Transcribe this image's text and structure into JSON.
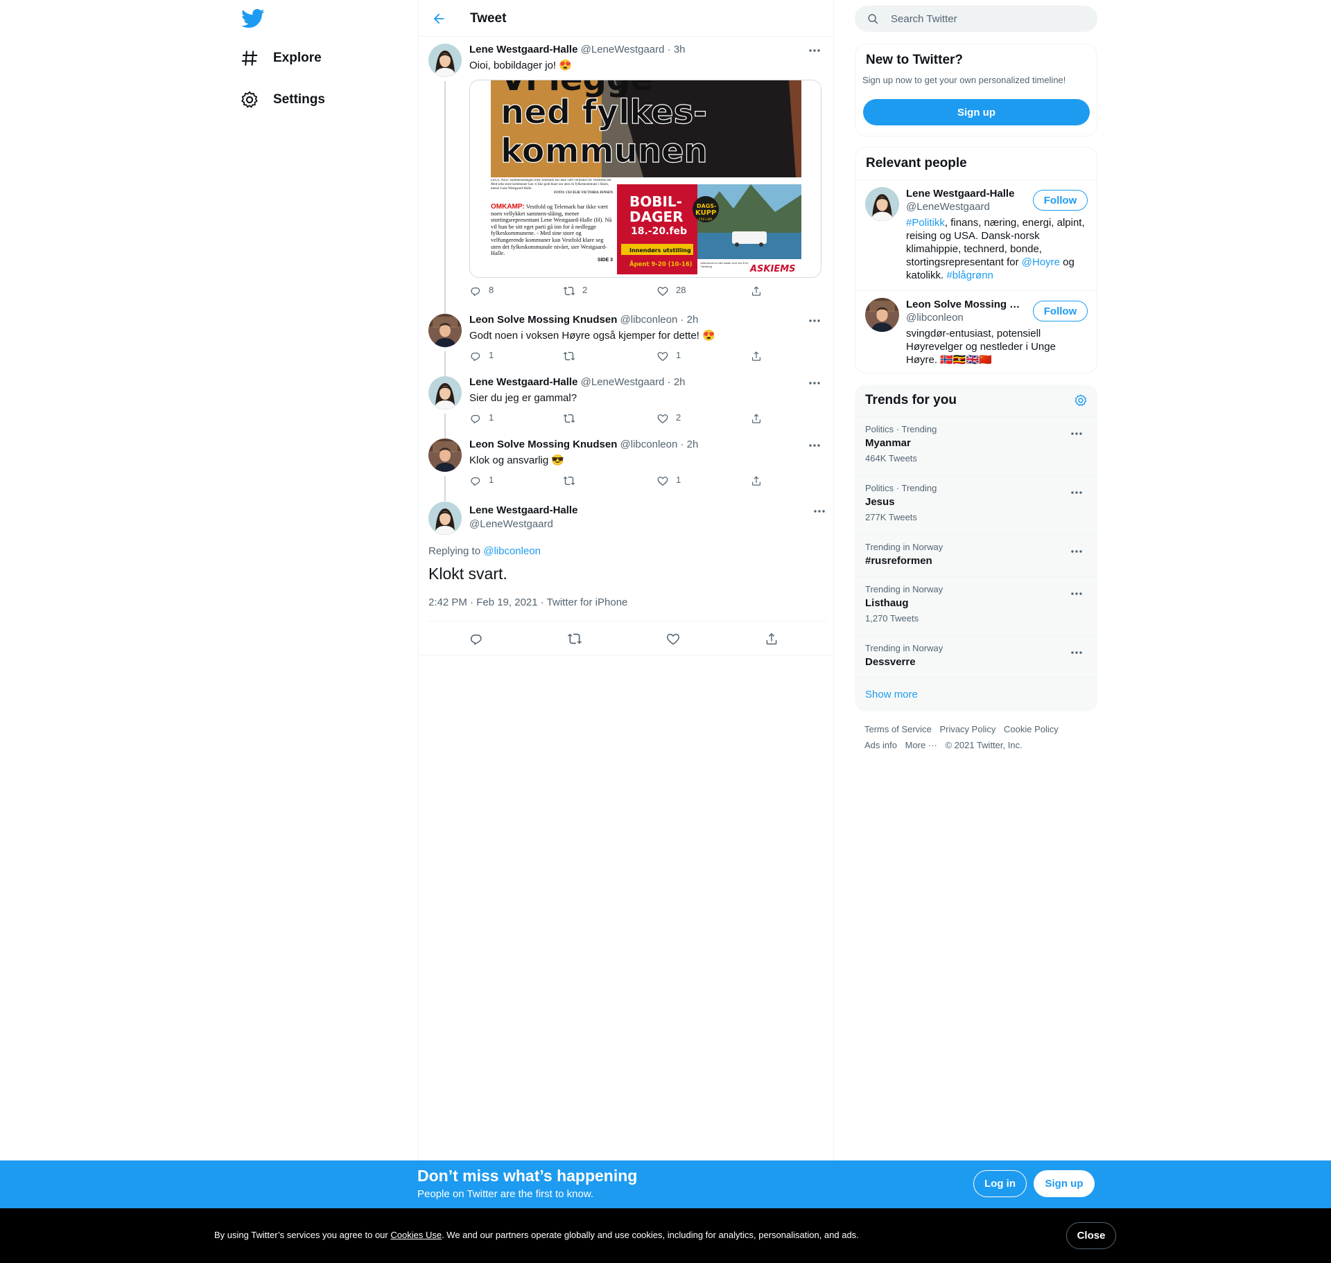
{
  "nav": {
    "explore_label": "Explore",
    "settings_label": "Settings"
  },
  "header": {
    "title": "Tweet"
  },
  "thread": [
    {
      "name": "Lene Westgaard-Halle",
      "handle": "@LeneWestgaard",
      "time": "· 3h",
      "text": "Oioi, bobildager jo! 😍",
      "replies": "8",
      "retweets": "2",
      "likes": "28",
      "media": {
        "headline_1": "Vi legge",
        "headline_2": "ned fylkes-",
        "headline_3": "kommunen",
        "caption": "LEGG NED: Sammenslåingen med Telemark har ikke vært vellykket for Vestfolds del. Med seks store kommuner kan vi like godt klare oss uten en fylkeskommune i Skien, mener Lene Westgaard-Halle.",
        "photo_credit": "FOTO: CECILIE VICTORIA JENSEN",
        "kicker": "OMKAMP:",
        "body": "Vestfold og Telemark har ikke vært noen vellykket sammen-slåing, mener stortingsrepresentant Lene Westgaard-Halle (H). Nå vil hun be sitt eget parti gå inn for å nedlegge fylkeskommunene. - Med sine store og velfungerende kommuner kan Vestfold klare seg uten det fylkeskommunale nivået, sier Westgaard-Halle.",
        "page": "SIDE 3",
        "ad_title_1": "BOBIL-",
        "ad_title_2": "DAGER",
        "ad_dates": "18.-20.feb",
        "ad_badge_1": "DAGS-",
        "ad_badge_2": "KUPP",
        "ad_badge_3": "FRE-LØR",
        "ad_indoor": "Innendørs utstilling",
        "ad_hours": "Åpent 9-20 (10-16)",
        "ad_brand": "ASKIEMS",
        "ad_small": "Velkommen til vårt lokale cent ved E18, Tønsberg"
      }
    },
    {
      "name": "Leon Solve Mossing Knudsen",
      "handle": "@libconleon",
      "time": "· 2h",
      "text": "Godt noen i voksen Høyre også kjemper for dette! 😍",
      "replies": "1",
      "retweets": "",
      "likes": "1"
    },
    {
      "name": "Lene Westgaard-Halle",
      "handle": "@LeneWestgaard",
      "time": "· 2h",
      "text": "Sier du jeg er gammal?",
      "replies": "1",
      "retweets": "",
      "likes": "2"
    },
    {
      "name": "Leon Solve Mossing Knudsen",
      "handle": "@libconleon",
      "time": "· 2h",
      "text": "Klok og ansvarlig 😎",
      "replies": "1",
      "retweets": "",
      "likes": "1"
    }
  ],
  "focus": {
    "name": "Lene Westgaard-Halle",
    "handle": "@LeneWestgaard",
    "replying_prefix": "Replying to",
    "replying_handle": "@libconleon",
    "text": "Klokt svart.",
    "timestamp": "2:42 PM · Feb 19, 2021 · Twitter for iPhone"
  },
  "search": {
    "placeholder": "Search Twitter"
  },
  "new_to_twitter": {
    "title": "New to Twitter?",
    "subtitle": "Sign up now to get your own personalized timeline!",
    "button": "Sign up"
  },
  "relevant": {
    "title": "Relevant people",
    "people": [
      {
        "name": "Lene Westgaard-Halle",
        "handle": "@LeneWestgaard",
        "button": "Follow",
        "bio_parts": [
          "#Politikk",
          ", finans, næring, energi, alpint, reising og USA. Dansk-norsk klimahippie, technerd, bonde, stortingsrepresentant for ",
          "@Hoyre",
          " og katolikk. ",
          "#blågrønn"
        ]
      },
      {
        "name": "Leon Solve Mossing Knudsen",
        "handle": "@libconleon",
        "button": "Follow",
        "bio": "svingdør-entusiast, potensiell Høyrevelger og nestleder i Unge Høyre. 🇳🇴🇺🇬🇬🇧🇨🇳"
      }
    ]
  },
  "trends": {
    "title": "Trends for you",
    "items": [
      {
        "meta": "Politics · Trending",
        "name": "Myanmar",
        "count": "464K Tweets"
      },
      {
        "meta": "Politics · Trending",
        "name": "Jesus",
        "count": "277K Tweets"
      },
      {
        "meta": "Trending in Norway",
        "name": "#rusreformen",
        "count": ""
      },
      {
        "meta": "Trending in Norway",
        "name": "Listhaug",
        "count": "1,270 Tweets"
      },
      {
        "meta": "Trending in Norway",
        "name": "Dessverre",
        "count": ""
      }
    ],
    "show_more": "Show more"
  },
  "footer": {
    "links": [
      "Terms of Service",
      "Privacy Policy",
      "Cookie Policy",
      "Ads info",
      "More ···",
      "© 2021 Twitter, Inc."
    ]
  },
  "bottombar": {
    "title": "Don’t miss what’s happening",
    "subtitle": "People on Twitter are the first to know.",
    "login": "Log in",
    "signup": "Sign up"
  },
  "cookie": {
    "before": "By using Twitter’s services you agree to our ",
    "link": "Cookies Use",
    "after": ". We and our partners operate globally and use cookies, including for analytics, personalisation, and ads.",
    "close": "Close"
  },
  "colors": {
    "accent": "#1d9bf0",
    "text": "#0f1419",
    "muted": "#536471"
  }
}
